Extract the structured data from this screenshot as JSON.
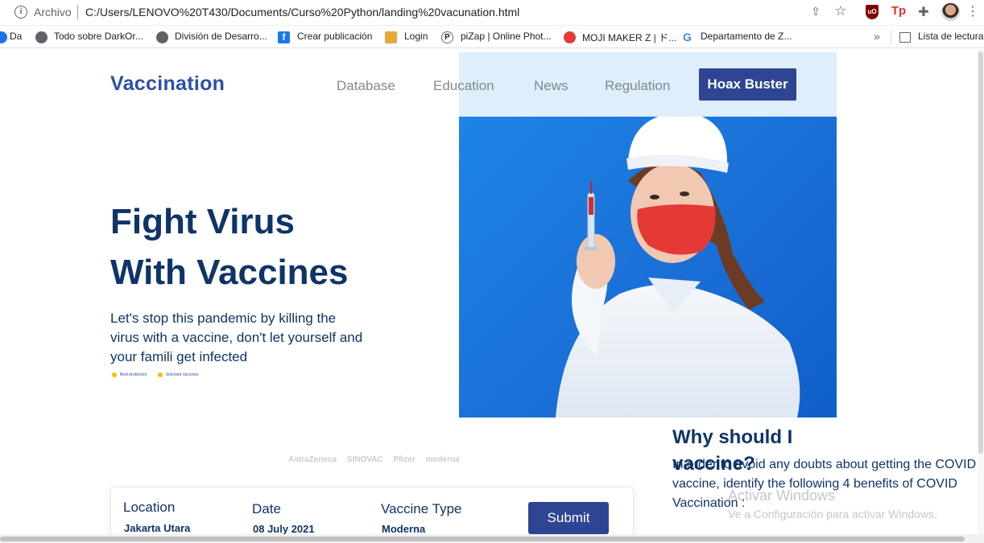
{
  "browser": {
    "scheme": "Archivo",
    "url": "C:/Users/LENOVO%20T430/Documents/Curso%20Python/landing%20vacunation.html",
    "bookmarks": [
      "Da",
      "Todo sobre DarkOr...",
      "División de Desarro...",
      "Crear publicación",
      "Login",
      "piZap | Online Phot...",
      "MOJI MAKER Z | ド...",
      "Departamento de Z..."
    ],
    "more": "»",
    "reading_list": "Lista de lectura",
    "icons": {
      "ublock": "uO",
      "tp": "Tp"
    }
  },
  "site": {
    "brand": "Vaccination",
    "nav": [
      "Database",
      "Education",
      "News",
      "Regulation"
    ],
    "cta": "Hoax Buster",
    "hero": {
      "title_line1": "Fight Virus",
      "title_line2": "With Vaccines",
      "subtitle": "Let's stop this pandemic by killing the virus with a vaccine, don't let yourself and your famili get infected",
      "badges": [
        "Best protection",
        "Selected Vaccines"
      ]
    },
    "partners": [
      "AstraZeneca",
      "SINOVAC",
      "Pfizer",
      "moderna"
    ],
    "why": {
      "title": "Why should I vaccine?",
      "text": "In order to avoid any doubts about getting the COVID vaccine, identify the following 4 benefits of COVID Vaccination :"
    },
    "form": {
      "location_label": "Location",
      "location_value": "Jakarta Utara",
      "date_label": "Date",
      "date_value": "08 July 2021",
      "type_label": "Vaccine Type",
      "type_value": "Moderna",
      "submit": "Submit"
    }
  },
  "os": {
    "watermark_title": "Activar Windows",
    "watermark_sub": "Ve a Configuración para activar Windows."
  },
  "colors": {
    "brand": "#2e4fa8",
    "heading": "#0f3468",
    "button": "#2e4593",
    "nav_bg": "#deeefb",
    "hero_blue": "#1a6fd6"
  }
}
